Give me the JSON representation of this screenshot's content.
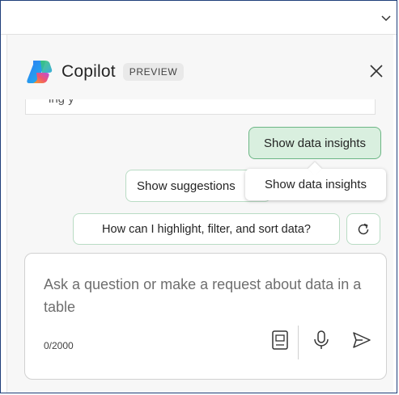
{
  "header": {
    "title": "Copilot",
    "badge": "PREVIEW"
  },
  "suggestions": {
    "active": "Show data insights",
    "secondary": "Show suggestions",
    "highlight": "How can I highlight, filter, and sort data?"
  },
  "tooltip": {
    "text": "Show data insights"
  },
  "composer": {
    "placeholder": "Ask a question or make a request about data in a table",
    "counter": "0/2000"
  },
  "icons": {
    "top_chevron": "chevron-down-icon",
    "logo": "copilot-logo-icon",
    "close": "close-icon",
    "refresh": "refresh-icon",
    "notebook": "notebook-icon",
    "mic": "microphone-icon",
    "send": "send-icon"
  },
  "colors": {
    "accent_green_bg": "#d9efdf",
    "accent_green_border": "#6cb685",
    "chip_border": "#b9dcc4",
    "frame_border": "#1f3f7a"
  }
}
